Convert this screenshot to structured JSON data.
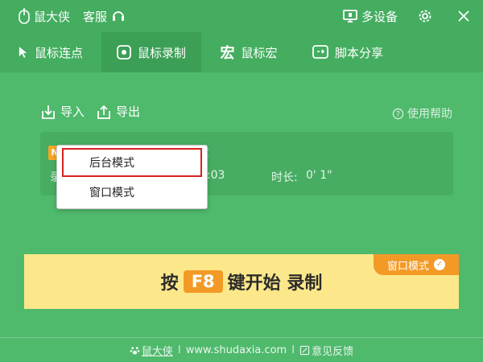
{
  "titlebar": {
    "app_name": "鼠大侠",
    "support": "客服",
    "multi_device": "多设备"
  },
  "tabs": [
    {
      "label": "鼠标连点",
      "icon": "cursor-arrow-icon"
    },
    {
      "label": "鼠标录制",
      "icon": "record-icon"
    },
    {
      "label": "鼠标宏",
      "icon": "macro-icon",
      "glyph": "宏"
    },
    {
      "label": "脚本分享",
      "icon": "script-share-icon"
    }
  ],
  "toolbar": {
    "import_label": "导入",
    "export_label": "导出",
    "help_label": "使用帮助"
  },
  "record": {
    "badge": "N",
    "name_suffix": "2",
    "label_prefix": "录",
    "time_suffix": "0:03",
    "duration_label": "时长:",
    "duration_value": "0' 1\""
  },
  "popup": {
    "option1": "后台模式",
    "option2": "窗口模式"
  },
  "banner": {
    "press": "按",
    "key": "F8",
    "rest": "键开始 录制",
    "tag": "窗口模式",
    "tag_check": "✓"
  },
  "footer": {
    "brand": "鼠大侠",
    "separator": "I",
    "url": "www.shudaxia.com",
    "feedback": "意见反馈"
  }
}
